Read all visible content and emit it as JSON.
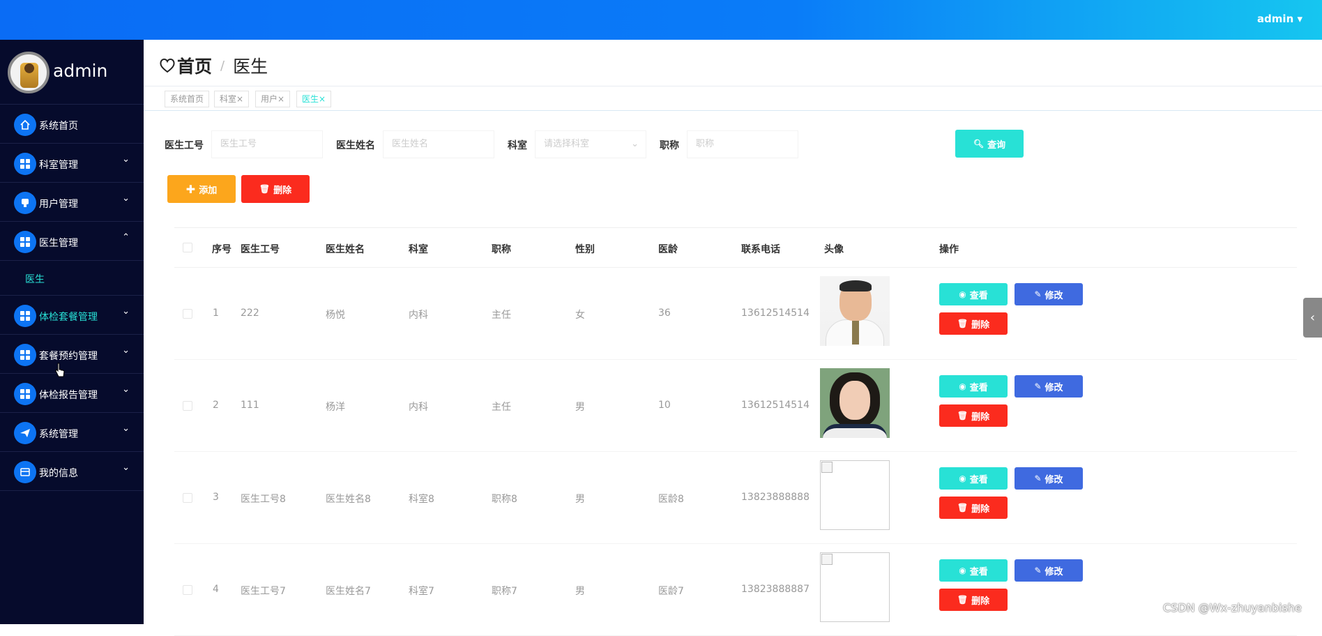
{
  "topbar": {
    "user_label": "admin ▾"
  },
  "sidebar": {
    "profile_name": "admin",
    "items": [
      {
        "label": "系统首页",
        "chevron": ""
      },
      {
        "label": "科室管理",
        "chevron": "⌄"
      },
      {
        "label": "用户管理",
        "chevron": "⌄"
      },
      {
        "label": "医生管理",
        "chevron": "⌃"
      },
      {
        "label": "医生"
      },
      {
        "label": "体检套餐管理",
        "chevron": "⌄"
      },
      {
        "label": "套餐预约管理",
        "chevron": "⌄"
      },
      {
        "label": "体检报告管理",
        "chevron": "⌄"
      },
      {
        "label": "系统管理",
        "chevron": "⌄"
      },
      {
        "label": "我的信息",
        "chevron": "⌄"
      }
    ]
  },
  "breadcrumb": {
    "home": "首页",
    "sep": "/",
    "current": "医生"
  },
  "tags": [
    "系统首页",
    "科室×",
    "用户×",
    "医生×"
  ],
  "search": {
    "fields": [
      {
        "label": "医生工号",
        "placeholder": "医生工号"
      },
      {
        "label": "医生姓名",
        "placeholder": "医生姓名"
      },
      {
        "label": "科室",
        "placeholder": "请选择科室"
      },
      {
        "label": "职称",
        "placeholder": "职称"
      }
    ],
    "query_label": "查询"
  },
  "toolbar": {
    "add_label": "添加",
    "delete_label": "删除"
  },
  "table": {
    "headers": [
      "序号",
      "医生工号",
      "医生姓名",
      "科室",
      "职称",
      "性别",
      "医龄",
      "联系电话",
      "头像",
      "操作"
    ],
    "rows": [
      {
        "idx": "1",
        "no": "222",
        "name": "杨悦",
        "dept": "内科",
        "title": "主任",
        "gender": "女",
        "age": "36",
        "phone": "13612514514"
      },
      {
        "idx": "2",
        "no": "111",
        "name": "杨洋",
        "dept": "内科",
        "title": "主任",
        "gender": "男",
        "age": "10",
        "phone": "13612514514"
      },
      {
        "idx": "3",
        "no": "医生工号8",
        "name": "医生姓名8",
        "dept": "科室8",
        "title": "职称8",
        "gender": "男",
        "age": "医龄8",
        "phone": "13823888888"
      },
      {
        "idx": "4",
        "no": "医生工号7",
        "name": "医生姓名7",
        "dept": "科室7",
        "title": "职称7",
        "gender": "男",
        "age": "医龄7",
        "phone": "13823888887"
      }
    ],
    "actions": {
      "view": "查看",
      "edit": "修改",
      "delete": "删除"
    }
  },
  "watermark": "CSDN @Wx-zhuyanbishe"
}
